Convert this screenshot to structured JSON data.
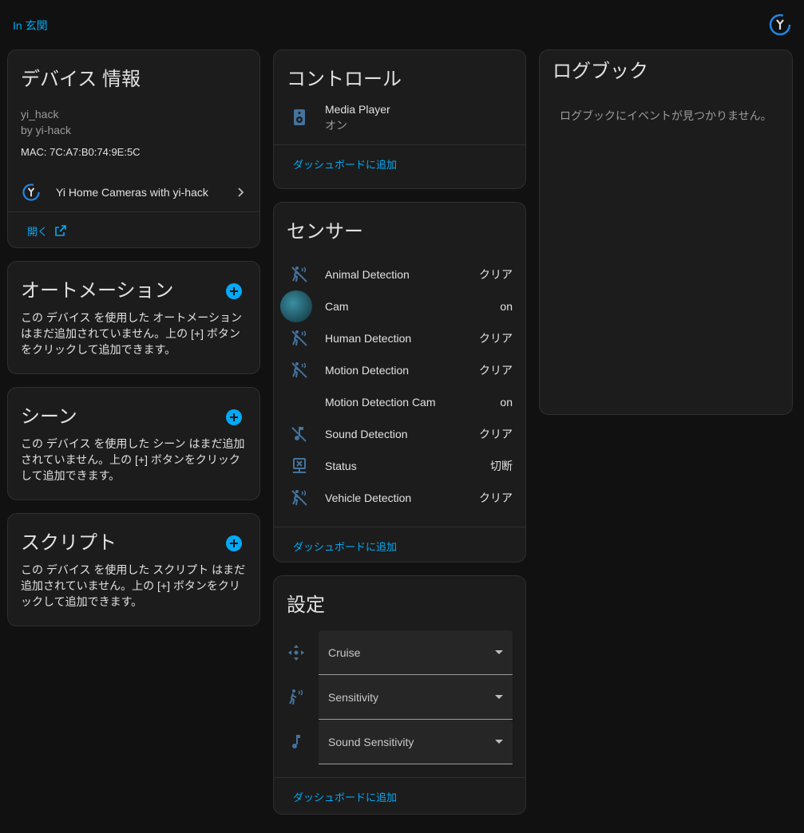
{
  "topbar": {
    "area_link": "In 玄関",
    "logo": "yi-logo-icon"
  },
  "device_info": {
    "title": "デバイス 情報",
    "model": "yi_hack",
    "manufacturer": "by yi-hack",
    "mac": "MAC: 7C:A7:B0:74:9E:5C",
    "integration": "Yi Home Cameras with yi-hack",
    "open_label": "開く"
  },
  "automations": {
    "title": "オートメーション",
    "empty": "この デバイス を使用した オートメーション はまだ追加されていません。上の [+] ボタンをクリックして追加できます。"
  },
  "scenes": {
    "title": "シーン",
    "empty": "この デバイス を使用した シーン はまだ追加されていません。上の [+] ボタンをクリックして追加できます。"
  },
  "scripts": {
    "title": "スクリプト",
    "empty": "この デバイス を使用した スクリプト はまだ追加されていません。上の [+] ボタンをクリックして追加できます。"
  },
  "controls": {
    "title": "コントロール",
    "entity_name": "Media Player",
    "entity_state": "オン",
    "add_label": "ダッシュボードに追加"
  },
  "sensors": {
    "title": "センサー",
    "items": [
      {
        "name": "Animal Detection",
        "state": "クリア",
        "icon": "motion-sensor-off-icon"
      },
      {
        "name": "Cam",
        "state": "on",
        "icon": "camera-thumbnail"
      },
      {
        "name": "Human Detection",
        "state": "クリア",
        "icon": "motion-sensor-off-icon"
      },
      {
        "name": "Motion Detection",
        "state": "クリア",
        "icon": "motion-sensor-off-icon"
      },
      {
        "name": "Motion Detection Cam",
        "state": "on",
        "icon": ""
      },
      {
        "name": "Sound Detection",
        "state": "クリア",
        "icon": "music-note-off-icon"
      },
      {
        "name": "Status",
        "state": "切断",
        "icon": "lan-disconnect-icon"
      },
      {
        "name": "Vehicle Detection",
        "state": "クリア",
        "icon": "motion-sensor-off-icon"
      }
    ],
    "add_label": "ダッシュボードに追加"
  },
  "settings": {
    "title": "設定",
    "items": [
      {
        "label": "Cruise",
        "icon": "move-arrows-icon"
      },
      {
        "label": "Sensitivity",
        "icon": "motion-sensor-icon"
      },
      {
        "label": "Sound Sensitivity",
        "icon": "music-note-icon"
      }
    ],
    "add_label": "ダッシュボードに追加"
  },
  "logbook": {
    "title": "ログブック",
    "empty": "ログブックにイベントが見つかりません。"
  },
  "colors": {
    "accent": "#03a9f4",
    "icon": "#44739e",
    "background": "#111111",
    "card": "#1c1c1c"
  }
}
